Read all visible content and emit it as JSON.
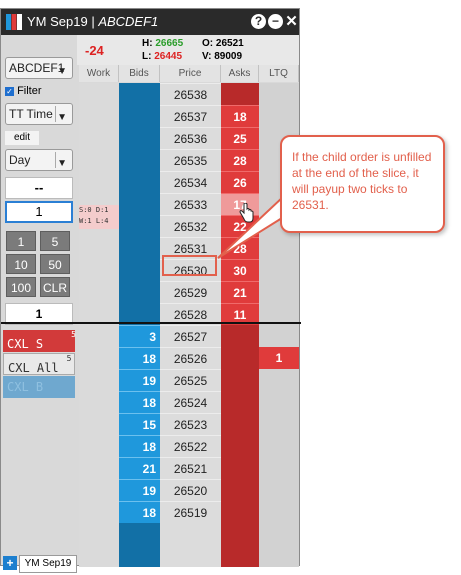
{
  "title": {
    "instrument": "YM Sep19",
    "separator": " | ",
    "account": "ABCDEF1"
  },
  "stats": {
    "change": "-24",
    "high_label": "H:",
    "high": "26665",
    "low_label": "L:",
    "low": "26445",
    "open_label": "O:",
    "open": "26521",
    "volume_label": "V:",
    "volume": "89009"
  },
  "left_panel": {
    "account_select": "ABCDEF1",
    "filter_label": "Filter",
    "filter_checked": true,
    "tif_select": "TT Time",
    "edit_label": "edit",
    "duration_select": "Day",
    "blank_value": "--",
    "qty_value": "1",
    "info": [
      "S:0 D:1",
      "W:1 L:4"
    ],
    "qty_buttons": [
      "1",
      "5",
      "10",
      "50",
      "100",
      "CLR"
    ],
    "default_qty": "1",
    "cxl_sell": "CXL S",
    "cxl_sell_count": "5",
    "cxl_all": "CXL All",
    "cxl_all_count": "5",
    "cxl_buy": "CXL B"
  },
  "columns": [
    "Work",
    "Bids",
    "Price",
    "Asks",
    "LTQ"
  ],
  "rows": [
    {
      "price": "26538",
      "bid": "",
      "ask": "",
      "ltq": ""
    },
    {
      "price": "26537",
      "bid": "",
      "ask": "18",
      "ltq": ""
    },
    {
      "price": "26536",
      "bid": "",
      "ask": "25",
      "ltq": ""
    },
    {
      "price": "26535",
      "bid": "",
      "ask": "28",
      "ltq": ""
    },
    {
      "price": "26534",
      "bid": "",
      "ask": "26",
      "ltq": ""
    },
    {
      "price": "26533",
      "bid": "",
      "ask": "17",
      "ltq": ""
    },
    {
      "price": "26532",
      "bid": "",
      "ask": "22",
      "ltq": ""
    },
    {
      "price": "26531",
      "bid": "",
      "ask": "28",
      "ltq": ""
    },
    {
      "price": "26530",
      "bid": "",
      "ask": "30",
      "ltq": ""
    },
    {
      "price": "26529",
      "bid": "",
      "ask": "21",
      "ltq": ""
    },
    {
      "price": "26528",
      "bid": "",
      "ask": "11",
      "ltq": ""
    },
    {
      "price": "26527",
      "bid": "3",
      "ask": "",
      "ltq": ""
    },
    {
      "price": "26526",
      "bid": "18",
      "ask": "",
      "ltq": "1"
    },
    {
      "price": "26525",
      "bid": "19",
      "ask": "",
      "ltq": ""
    },
    {
      "price": "26524",
      "bid": "18",
      "ask": "",
      "ltq": ""
    },
    {
      "price": "26523",
      "bid": "15",
      "ask": "",
      "ltq": ""
    },
    {
      "price": "26522",
      "bid": "18",
      "ask": "",
      "ltq": ""
    },
    {
      "price": "26521",
      "bid": "21",
      "ask": "",
      "ltq": ""
    },
    {
      "price": "26520",
      "bid": "19",
      "ask": "",
      "ltq": ""
    },
    {
      "price": "26519",
      "bid": "18",
      "ask": "",
      "ltq": ""
    }
  ],
  "callout_text": "If the child order is unfilled at the end of the slice, it will payup two ticks to 26531.",
  "tab_label": "YM Sep19",
  "colors": {
    "bid_dark": "#1270a6",
    "bid_light": "#1f98dc",
    "ask_dark": "#b82a2a",
    "ask_bright": "#e03b3b",
    "callout": "#e2604c"
  }
}
